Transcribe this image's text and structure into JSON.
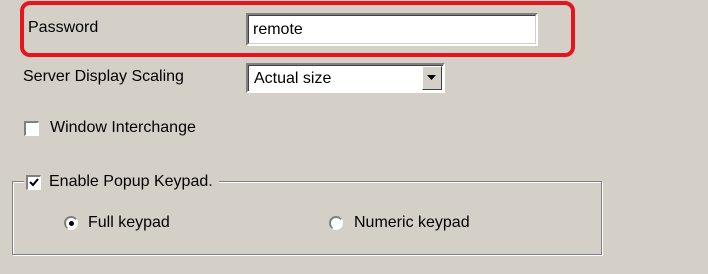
{
  "password": {
    "label": "Password",
    "value": "remote"
  },
  "scaling": {
    "label": "Server Display Scaling",
    "selected": "Actual size"
  },
  "window_interchange": {
    "label": "Window Interchange",
    "checked": false
  },
  "popup_keypad": {
    "label": "Enable Popup Keypad.",
    "checked": true,
    "options": [
      {
        "label": "Full keypad",
        "selected": true
      },
      {
        "label": "Numeric keypad",
        "selected": false
      }
    ]
  },
  "colors": {
    "highlight": "#e8141b",
    "background": "#d4d0c8"
  }
}
